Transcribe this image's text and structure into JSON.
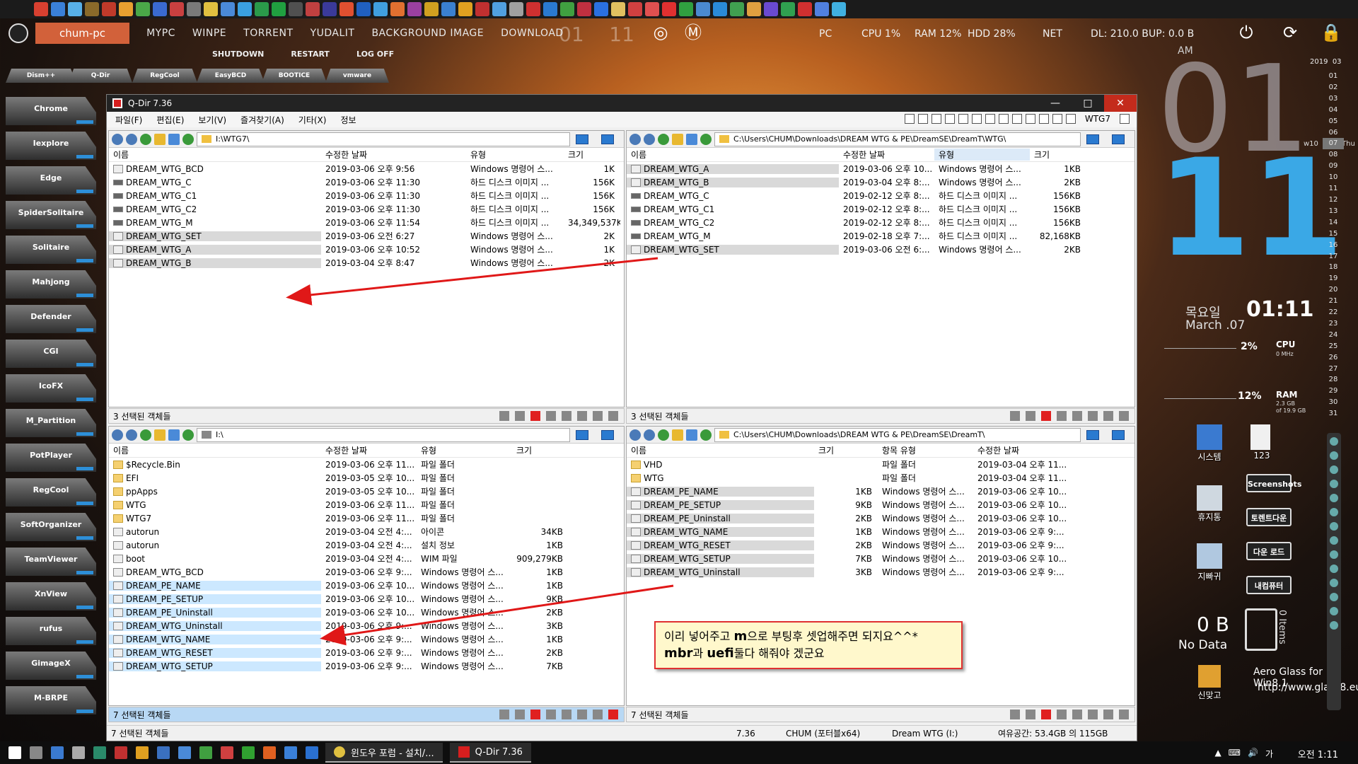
{
  "launcher_bar": {
    "icon_colors": [
      "#d84030",
      "#3a80d8",
      "#58b0e8",
      "#8a6a2a",
      "#c03a2a",
      "#e8a030",
      "#4aa848",
      "#3a6ad0",
      "#c84040",
      "#7a7a7a",
      "#e0c040",
      "#4a8ad8",
      "#3aa0e0",
      "#2a9a4a",
      "#20a040",
      "#505050",
      "#c04040",
      "#3a3a9a",
      "#e05030",
      "#2060c0",
      "#40a0e0",
      "#e07030",
      "#9a40a0",
      "#d0a020",
      "#3a80d0",
      "#e0a020",
      "#c03030",
      "#50a0e0",
      "#a0a0a0",
      "#d03030",
      "#2a7ad0",
      "#40a040",
      "#c03040",
      "#2a70e0",
      "#e0c060",
      "#d04040",
      "#e05050",
      "#e03030",
      "#30a040",
      "#4a8ad0",
      "#2a8ad8",
      "#40a050",
      "#e0a040",
      "#6a4ad0",
      "#30a050",
      "#d03030",
      "#5080e0",
      "#40b0e0"
    ]
  },
  "topbar": {
    "pc_name": "chum-pc",
    "nav": [
      "MYPC",
      "WINPE",
      "TORRENT",
      "YUDALIT",
      "BACKGROUND IMAGE",
      "DOWNLOAD"
    ],
    "clock_hour": "01",
    "clock_min": "11",
    "pc_label": "PC",
    "cpu": "CPU  1%",
    "ram": "RAM  12%",
    "hdd": "HDD  28%",
    "net_label": "NET",
    "dl": "DL:  210.0 B",
    "ul": "UP:  0.0 B",
    "power_icon": "⏻",
    "refresh_icon": "⟳",
    "lock_icon": "🔒"
  },
  "submenu": [
    "SHUTDOWN",
    "RESTART",
    "LOG OFF"
  ],
  "tool_tabs": [
    "Dism++",
    "Q-Dir",
    "RegCool",
    "EasyBCD",
    "BOOTICE",
    "vmware"
  ],
  "side_launcher": [
    "Chrome",
    "Iexplore",
    "Edge",
    "SpiderSolitaire",
    "Solitaire",
    "Mahjong",
    "Defender",
    "CGI",
    "IcoFX",
    "M_Partition",
    "PotPlayer",
    "RegCool",
    "SoftOrganizer",
    "TeamViewer",
    "XnView",
    "rufus",
    "GimageX",
    "M-BRPE"
  ],
  "window": {
    "title": "Q-Dir 7.36",
    "minimize": "—",
    "maximize": "□",
    "close": "✕",
    "menu": [
      "파일(F)",
      "편집(E)",
      "보기(V)",
      "즐겨찾기(A)",
      "기타(X)",
      "정보"
    ],
    "profile_name": "WTG7"
  },
  "pane_tl": {
    "address": "I:\\WTG7\\",
    "headers": [
      "이름",
      "수정한 날짜",
      "유형",
      "크기"
    ],
    "rows": [
      {
        "name": "DREAM_WTG_BCD",
        "date": "2019-03-06 오후 9:56",
        "type": "Windows 명령어 스...",
        "size": "1K",
        "icon": "file",
        "sel": ""
      },
      {
        "name": "DREAM_WTG_C",
        "date": "2019-03-06 오후 11:30",
        "type": "하드 디스크 이미지 ...",
        "size": "156K",
        "icon": "disk",
        "sel": ""
      },
      {
        "name": "DREAM_WTG_C1",
        "date": "2019-03-06 오후 11:30",
        "type": "하드 디스크 이미지 ...",
        "size": "156K",
        "icon": "disk",
        "sel": ""
      },
      {
        "name": "DREAM_WTG_C2",
        "date": "2019-03-06 오후 11:30",
        "type": "하드 디스크 이미지 ...",
        "size": "156K",
        "icon": "disk",
        "sel": ""
      },
      {
        "name": "DREAM_WTG_M",
        "date": "2019-03-06 오후 11:54",
        "type": "하드 디스크 이미지 ...",
        "size": "34,349,537K",
        "icon": "disk",
        "sel": ""
      },
      {
        "name": "DREAM_WTG_SET",
        "date": "2019-03-06 오전 6:27",
        "type": "Windows 명령어 스...",
        "size": "2K",
        "icon": "file",
        "sel": "gray"
      },
      {
        "name": "DREAM_WTG_A",
        "date": "2019-03-06 오후 10:52",
        "type": "Windows 명령어 스...",
        "size": "1K",
        "icon": "file",
        "sel": "gray"
      },
      {
        "name": "DREAM_WTG_B",
        "date": "2019-03-04 오후 8:47",
        "type": "Windows 명령어 스...",
        "size": "2K",
        "icon": "file",
        "sel": "gray"
      }
    ],
    "status": "3 선택된 객체들"
  },
  "pane_tr": {
    "address": "C:\\Users\\CHUM\\Downloads\\DREAM WTG & PE\\DreamSE\\DreamT\\WTG\\",
    "headers": [
      "이름",
      "수정한 날짜",
      "유형",
      "크기"
    ],
    "rows": [
      {
        "name": "DREAM_WTG_A",
        "date": "2019-03-06 오후 10...",
        "type": "Windows 명령어 스...",
        "size": "1KB",
        "icon": "file",
        "sel": "gray"
      },
      {
        "name": "DREAM_WTG_B",
        "date": "2019-03-04 오후 8:...",
        "type": "Windows 명령어 스...",
        "size": "2KB",
        "icon": "file",
        "sel": "gray"
      },
      {
        "name": "DREAM_WTG_C",
        "date": "2019-02-12 오후 8:...",
        "type": "하드 디스크 이미지 ...",
        "size": "156KB",
        "icon": "disk",
        "sel": ""
      },
      {
        "name": "DREAM_WTG_C1",
        "date": "2019-02-12 오후 8:...",
        "type": "하드 디스크 이미지 ...",
        "size": "156KB",
        "icon": "disk",
        "sel": ""
      },
      {
        "name": "DREAM_WTG_C2",
        "date": "2019-02-12 오후 8:...",
        "type": "하드 디스크 이미지 ...",
        "size": "156KB",
        "icon": "disk",
        "sel": ""
      },
      {
        "name": "DREAM_WTG_M",
        "date": "2019-02-18 오후 7:...",
        "type": "하드 디스크 이미지 ...",
        "size": "82,168KB",
        "icon": "disk",
        "sel": ""
      },
      {
        "name": "DREAM_WTG_SET",
        "date": "2019-03-06 오전 6:...",
        "type": "Windows 명령어 스...",
        "size": "2KB",
        "icon": "file",
        "sel": "gray"
      }
    ],
    "status": "3 선택된 객체들"
  },
  "pane_bl": {
    "address": "I:\\",
    "headers": [
      "이름",
      "수정한 날짜",
      "유형",
      "크기"
    ],
    "rows": [
      {
        "name": "$Recycle.Bin",
        "date": "2019-03-06 오후 11...",
        "type": "파일 폴더",
        "size": "",
        "icon": "folder",
        "sel": ""
      },
      {
        "name": "EFI",
        "date": "2019-03-05 오후 10...",
        "type": "파일 폴더",
        "size": "",
        "icon": "folder",
        "sel": ""
      },
      {
        "name": "ppApps",
        "date": "2019-03-05 오후 10...",
        "type": "파일 폴더",
        "size": "",
        "icon": "folder",
        "sel": ""
      },
      {
        "name": "WTG",
        "date": "2019-03-06 오후 11...",
        "type": "파일 폴더",
        "size": "",
        "icon": "folder",
        "sel": ""
      },
      {
        "name": "WTG7",
        "date": "2019-03-06 오후 11...",
        "type": "파일 폴더",
        "size": "",
        "icon": "folder",
        "sel": ""
      },
      {
        "name": "autorun",
        "date": "2019-03-04 오전 4:...",
        "type": "아이콘",
        "size": "34KB",
        "icon": "file",
        "sel": ""
      },
      {
        "name": "autorun",
        "date": "2019-03-04 오전 4:...",
        "type": "설치 정보",
        "size": "1KB",
        "icon": "file",
        "sel": ""
      },
      {
        "name": "boot",
        "date": "2019-03-04 오전 4:...",
        "type": "WIM 파일",
        "size": "909,279KB",
        "icon": "file",
        "sel": ""
      },
      {
        "name": "DREAM_WTG_BCD",
        "date": "2019-03-06 오후 9:...",
        "type": "Windows 명령어 스...",
        "size": "1KB",
        "icon": "file",
        "sel": ""
      },
      {
        "name": "DREAM_PE_NAME",
        "date": "2019-03-06 오후 10...",
        "type": "Windows 명령어 스...",
        "size": "1KB",
        "icon": "file",
        "sel": "blue"
      },
      {
        "name": "DREAM_PE_SETUP",
        "date": "2019-03-06 오후 10...",
        "type": "Windows 명령어 스...",
        "size": "9KB",
        "icon": "file",
        "sel": "blue"
      },
      {
        "name": "DREAM_PE_Uninstall",
        "date": "2019-03-06 오후 10...",
        "type": "Windows 명령어 스...",
        "size": "2KB",
        "icon": "file",
        "sel": "blue"
      },
      {
        "name": "DREAM_WTG_Uninstall",
        "date": "2019-03-06 오후 9:...",
        "type": "Windows 명령어 스...",
        "size": "3KB",
        "icon": "file",
        "sel": "blue"
      },
      {
        "name": "DREAM_WTG_NAME",
        "date": "2019-03-06 오후 9:...",
        "type": "Windows 명령어 스...",
        "size": "1KB",
        "icon": "file",
        "sel": "blue"
      },
      {
        "name": "DREAM_WTG_RESET",
        "date": "2019-03-06 오후 9:...",
        "type": "Windows 명령어 스...",
        "size": "2KB",
        "icon": "file",
        "sel": "blue"
      },
      {
        "name": "DREAM_WTG_SETUP",
        "date": "2019-03-06 오후 9:...",
        "type": "Windows 명령어 스...",
        "size": "7KB",
        "icon": "file",
        "sel": "blue"
      }
    ],
    "status": "7 선택된 객체들"
  },
  "pane_br": {
    "address": "C:\\Users\\CHUM\\Downloads\\DREAM WTG & PE\\DreamSE\\DreamT\\",
    "headers": [
      "이름",
      "크기",
      "항목 유형",
      "수정한 날짜"
    ],
    "rows": [
      {
        "name": "VHD",
        "size": "",
        "type": "파일 폴더",
        "date": "2019-03-04 오후 11...",
        "icon": "folder",
        "sel": ""
      },
      {
        "name": "WTG",
        "size": "",
        "type": "파일 폴더",
        "date": "2019-03-04 오후 11...",
        "icon": "folder",
        "sel": ""
      },
      {
        "name": "DREAM_PE_NAME",
        "size": "1KB",
        "type": "Windows 명령어 스...",
        "date": "2019-03-06 오후 10...",
        "icon": "file",
        "sel": "gray"
      },
      {
        "name": "DREAM_PE_SETUP",
        "size": "9KB",
        "type": "Windows 명령어 스...",
        "date": "2019-03-06 오후 10...",
        "icon": "file",
        "sel": "gray"
      },
      {
        "name": "DREAM_PE_Uninstall",
        "size": "2KB",
        "type": "Windows 명령어 스...",
        "date": "2019-03-06 오후 10...",
        "icon": "file",
        "sel": "gray"
      },
      {
        "name": "DREAM_WTG_NAME",
        "size": "1KB",
        "type": "Windows 명령어 스...",
        "date": "2019-03-06 오후 9:...",
        "icon": "file",
        "sel": "gray"
      },
      {
        "name": "DREAM_WTG_RESET",
        "size": "2KB",
        "type": "Windows 명령어 스...",
        "date": "2019-03-06 오후 9:...",
        "icon": "file",
        "sel": "gray"
      },
      {
        "name": "DREAM_WTG_SETUP",
        "size": "7KB",
        "type": "Windows 명령어 스...",
        "date": "2019-03-06 오후 10...",
        "icon": "file",
        "sel": "gray"
      },
      {
        "name": "DREAM_WTG_Uninstall",
        "size": "3KB",
        "type": "Windows 명령어 스...",
        "date": "2019-03-06 오후 9:...",
        "icon": "file",
        "sel": "gray"
      }
    ],
    "status": "7 선택된 객체들"
  },
  "bottom_status": {
    "left": "7 선택된 객체들",
    "version": "7.36",
    "user": "CHUM (포터블x64)",
    "drive": "Dream WTG (I:)",
    "space": "여유공간: 53.4GB 의 115GB"
  },
  "note": {
    "line1_a": "이리 넣어주고 ",
    "line1_b": "m",
    "line1_c": "으로 부팅후 셋업해주면 되지요^^*",
    "line2_a": "mbr",
    "line2_b": "과 ",
    "line2_c": "uefi",
    "line2_d": "둘다 해줘야 겠군요"
  },
  "desktop_clock": {
    "ampm": "AM",
    "hour": "01",
    "minute": "11",
    "weekday": "목요일",
    "month": "March .07",
    "time": "01:11",
    "cal_year": "2019",
    "cal_month": "03",
    "week": "w10",
    "dow": "Thu",
    "days": [
      "01",
      "02",
      "03",
      "04",
      "05",
      "06",
      "07",
      "08",
      "09",
      "10",
      "11",
      "12",
      "13",
      "14",
      "15",
      "16",
      "17",
      "18",
      "19",
      "20",
      "21",
      "22",
      "23",
      "24",
      "25",
      "26",
      "27",
      "28",
      "29",
      "30",
      "31"
    ],
    "today": "07"
  },
  "meters": {
    "cpu_pct": "2%",
    "cpu_lbl": "CPU",
    "cpu_sub": "0 MHz",
    "ram_pct": "12%",
    "ram_lbl": "RAM",
    "ram_sub1": "2.3 GB",
    "ram_sub2": "of 19.9 GB"
  },
  "desktop": {
    "system": "시스템",
    "num": "123",
    "trash": "휴지통",
    "wipe": "지빠귀",
    "game": "신맞고",
    "btn_screenshots": "Screenshots",
    "btn_torrent": "토렌트다운",
    "btn_download": "다운 로드",
    "btn_mycomputer": "내컴퓨터",
    "recycle_size": "0 B",
    "recycle_sub": "No Data",
    "recycle_items": "0 Items",
    "aero1": "Aero Glass for Win8.1",
    "aero2": "http://www.glass8.eu"
  },
  "taskbar": {
    "tasks": [
      "윈도우 포럼 - 설치/...",
      "Q-Dir 7.36"
    ],
    "time": "오전 1:11",
    "tray": [
      "▲",
      "⌨",
      "🔊",
      "가"
    ]
  }
}
